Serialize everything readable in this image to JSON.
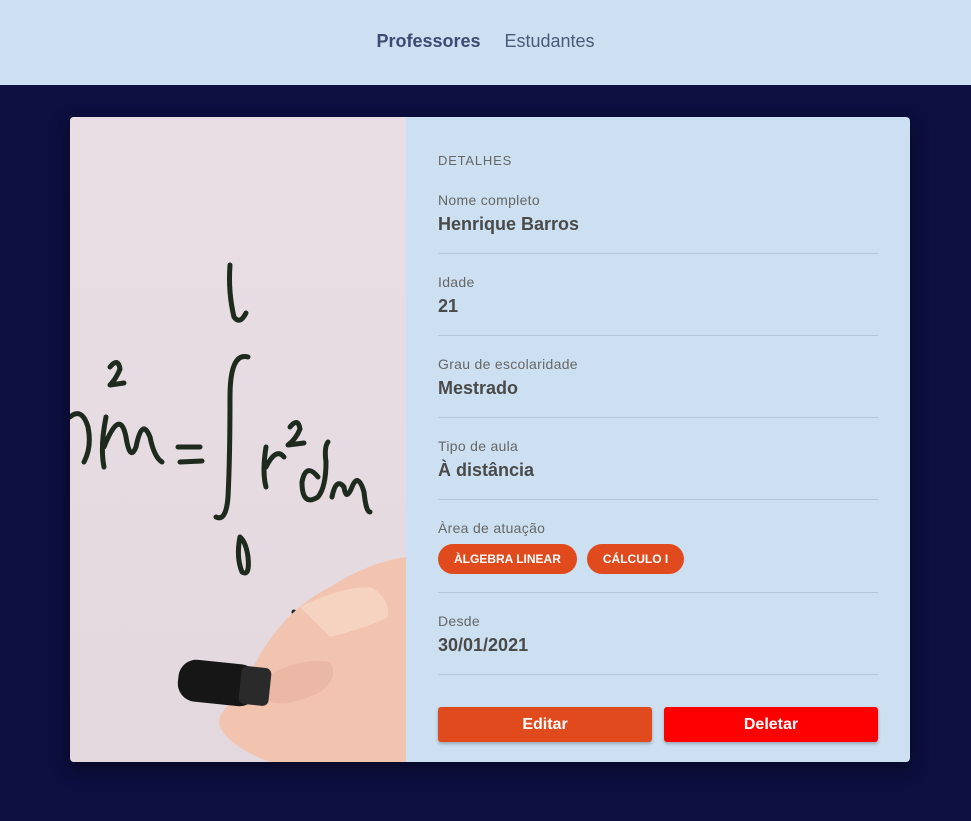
{
  "nav": {
    "items": [
      {
        "label": "Professores",
        "active": true
      },
      {
        "label": "Estudantes",
        "active": false
      }
    ]
  },
  "details": {
    "section_title": "DETALHES",
    "full_name_label": "Nome completo",
    "full_name": "Henrique Barros",
    "age_label": "Idade",
    "age": "21",
    "education_label": "Grau de escolaridade",
    "education": "Mestrado",
    "class_type_label": "Tipo de aula",
    "class_type": "À distância",
    "area_label": "Àrea de atuação",
    "areas": [
      "ÀLGEBRA LINEAR",
      "CÁLCULO I"
    ],
    "since_label": "Desde",
    "since": "30/01/2021"
  },
  "actions": {
    "edit_label": "Editar",
    "delete_label": "Deletar"
  },
  "colors": {
    "background": "#0c0f3f",
    "panel": "#cce0f2",
    "accent": "#e04a1d",
    "danger": "#ff0000"
  }
}
